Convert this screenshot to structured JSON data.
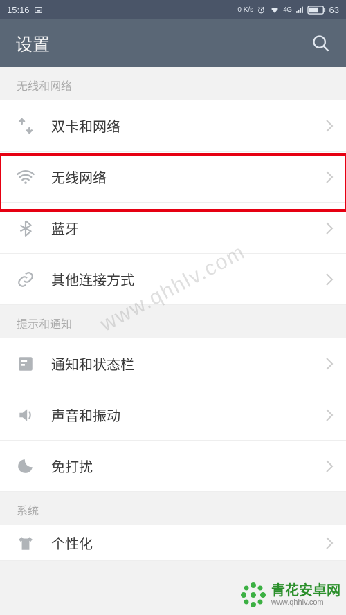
{
  "status_bar": {
    "time": "15:16",
    "data_rate": "0 K/s",
    "network_badge": "4G",
    "battery": "63"
  },
  "header": {
    "title": "设置"
  },
  "section_wireless": {
    "title": "无线和网络",
    "item_sim": "双卡和网络",
    "item_wifi": "无线网络",
    "item_bluetooth": "蓝牙",
    "item_other": "其他连接方式"
  },
  "section_notify": {
    "title": "提示和通知",
    "item_notif": "通知和状态栏",
    "item_sound": "声音和振动",
    "item_dnd": "免打扰"
  },
  "section_system": {
    "title": "系统",
    "item_personal": "个性化"
  },
  "watermark": {
    "diag": "www.qhhlv.com",
    "brand_name": "青花安卓网",
    "brand_url": "www.qhhlv.com"
  }
}
